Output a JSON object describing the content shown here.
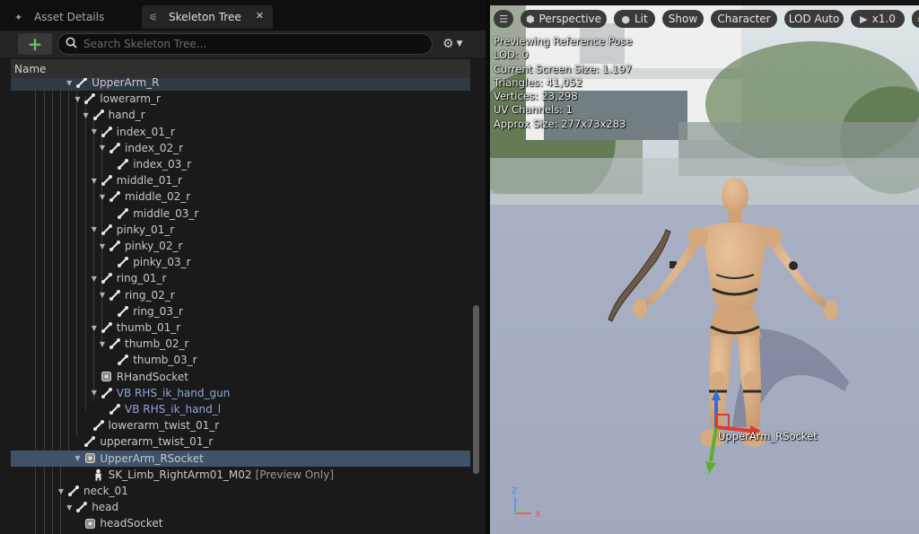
{
  "tabs": [
    {
      "label": "Asset Details",
      "icon": "skeleton-asset-icon",
      "active": false
    },
    {
      "label": "Skeleton Tree",
      "icon": "skeleton-tree-icon",
      "active": true
    }
  ],
  "toolbar": {
    "add_label": "+",
    "search_placeholder": "Search Skeleton Tree..."
  },
  "column_header": "Name",
  "tree": [
    {
      "label": "UpperArm_R",
      "depth": 6,
      "icon": "bone",
      "expander": "down",
      "ghost": true
    },
    {
      "label": "lowerarm_r",
      "depth": 7,
      "icon": "bone",
      "expander": "down"
    },
    {
      "label": "hand_r",
      "depth": 8,
      "icon": "bone",
      "expander": "down"
    },
    {
      "label": "index_01_r",
      "depth": 9,
      "icon": "bone",
      "expander": "down"
    },
    {
      "label": "index_02_r",
      "depth": 10,
      "icon": "bone",
      "expander": "down"
    },
    {
      "label": "index_03_r",
      "depth": 11,
      "icon": "bone",
      "expander": ""
    },
    {
      "label": "middle_01_r",
      "depth": 9,
      "icon": "bone",
      "expander": "down"
    },
    {
      "label": "middle_02_r",
      "depth": 10,
      "icon": "bone",
      "expander": "down"
    },
    {
      "label": "middle_03_r",
      "depth": 11,
      "icon": "bone",
      "expander": ""
    },
    {
      "label": "pinky_01_r",
      "depth": 9,
      "icon": "bone",
      "expander": "down"
    },
    {
      "label": "pinky_02_r",
      "depth": 10,
      "icon": "bone",
      "expander": "down"
    },
    {
      "label": "pinky_03_r",
      "depth": 11,
      "icon": "bone",
      "expander": ""
    },
    {
      "label": "ring_01_r",
      "depth": 9,
      "icon": "bone",
      "expander": "down"
    },
    {
      "label": "ring_02_r",
      "depth": 10,
      "icon": "bone",
      "expander": "down"
    },
    {
      "label": "ring_03_r",
      "depth": 11,
      "icon": "bone",
      "expander": ""
    },
    {
      "label": "thumb_01_r",
      "depth": 9,
      "icon": "bone",
      "expander": "down"
    },
    {
      "label": "thumb_02_r",
      "depth": 10,
      "icon": "bone",
      "expander": "down"
    },
    {
      "label": "thumb_03_r",
      "depth": 11,
      "icon": "bone",
      "expander": ""
    },
    {
      "label": "RHandSocket",
      "depth": 9,
      "icon": "socket",
      "expander": ""
    },
    {
      "label": "VB RHS_ik_hand_gun",
      "depth": 9,
      "icon": "bone",
      "expander": "down",
      "virtual": true
    },
    {
      "label": "VB RHS_ik_hand_l",
      "depth": 10,
      "icon": "bone",
      "expander": "",
      "virtual": true
    },
    {
      "label": "lowerarm_twist_01_r",
      "depth": 8,
      "icon": "bone",
      "expander": ""
    },
    {
      "label": "upperarm_twist_01_r",
      "depth": 7,
      "icon": "bone",
      "expander": ""
    },
    {
      "label": "UpperArm_RSocket",
      "depth": 7,
      "icon": "socket",
      "expander": "down",
      "selected": true
    },
    {
      "label": "SK_Limb_RightArm01_M02",
      "suffix": "[Preview Only]",
      "depth": 8,
      "icon": "mesh",
      "expander": ""
    },
    {
      "label": "neck_01",
      "depth": 5,
      "icon": "bone",
      "expander": "down"
    },
    {
      "label": "head",
      "depth": 6,
      "icon": "bone",
      "expander": "down"
    },
    {
      "label": "headSocket",
      "depth": 7,
      "icon": "socket",
      "expander": ""
    }
  ],
  "viewport": {
    "buttons": [
      {
        "label": "",
        "icon": "hamburger-menu-icon",
        "w": 22
      },
      {
        "label": "Perspective",
        "icon": "cube-icon",
        "w": 96
      },
      {
        "label": "Lit",
        "icon": "sphere-icon",
        "w": 46
      },
      {
        "label": "Show",
        "icon": "",
        "w": 46
      },
      {
        "label": "Character",
        "icon": "",
        "w": 74
      },
      {
        "label": "LOD Auto",
        "icon": "",
        "w": 66
      },
      {
        "label": "x1.0",
        "icon": "play-icon",
        "w": 60
      },
      {
        "label": "",
        "icon": "double-chevron-right-icon",
        "w": 18
      }
    ],
    "stats": [
      "Previewing Reference Pose",
      "LOD: 0",
      "Current Screen Size: 1.197",
      "Triangles: 41,052",
      "Vertices: 23,298",
      "UV Channels: 1",
      "Approx Size: 277x73x283"
    ],
    "socket_label": "UpperArm_RSocket",
    "axis_labels": {
      "z": "Z",
      "x": "X"
    }
  },
  "colors": {
    "selected_row": "#3e5269",
    "virtual_bone": "#8ea6dc",
    "add_button": "#5fc35a",
    "axis_x": "#e03a2a",
    "axis_y": "#5cb02a",
    "axis_z": "#2e6fe0"
  }
}
